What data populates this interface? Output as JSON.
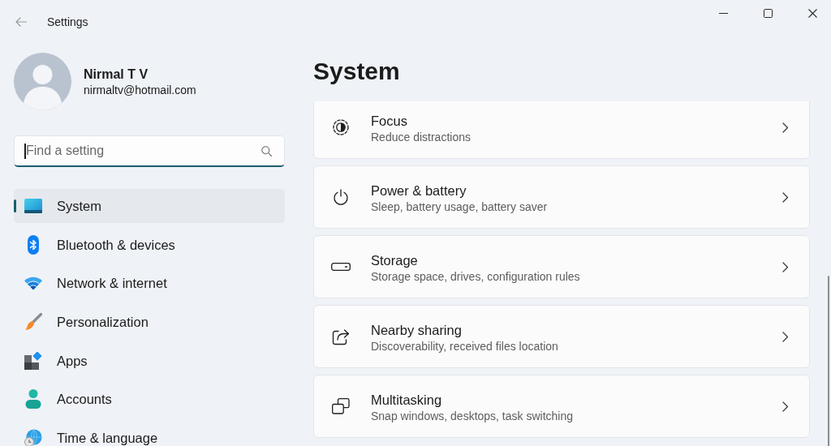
{
  "window": {
    "title": "Settings"
  },
  "profile": {
    "name": "Nirmal T V",
    "email": "nirmaltv@hotmail.com"
  },
  "search": {
    "placeholder": "Find a setting",
    "focused": true
  },
  "sidebar": {
    "items": [
      {
        "label": "System",
        "selected": true
      },
      {
        "label": "Bluetooth & devices",
        "selected": false
      },
      {
        "label": "Network & internet",
        "selected": false
      },
      {
        "label": "Personalization",
        "selected": false
      },
      {
        "label": "Apps",
        "selected": false
      },
      {
        "label": "Accounts",
        "selected": false
      },
      {
        "label": "Time & language",
        "selected": false
      }
    ]
  },
  "page": {
    "title": "System",
    "cards": [
      {
        "title": "Focus",
        "subtitle": "Reduce distractions"
      },
      {
        "title": "Power & battery",
        "subtitle": "Sleep, battery usage, battery saver"
      },
      {
        "title": "Storage",
        "subtitle": "Storage space, drives, configuration rules"
      },
      {
        "title": "Nearby sharing",
        "subtitle": "Discoverability, received files location"
      },
      {
        "title": "Multitasking",
        "subtitle": "Snap windows, desktops, task switching"
      }
    ]
  }
}
